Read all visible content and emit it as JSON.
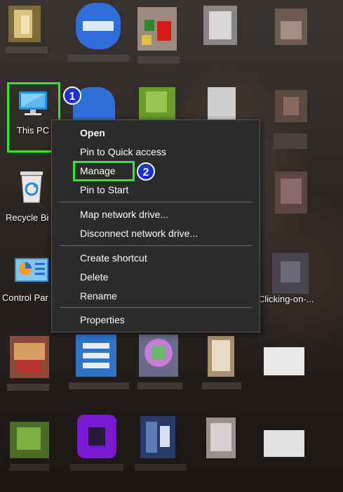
{
  "desktop": {
    "icons": [
      {
        "label": "This PC",
        "icon": "this-pc-icon"
      },
      {
        "label": "Recycle Bi",
        "icon": "recycle-bin-icon"
      },
      {
        "label": "Control Par",
        "icon": "control-panel-icon"
      }
    ],
    "partial_label": "Clicking-on-..."
  },
  "context_menu": {
    "items": [
      {
        "label": "Open",
        "bold": true
      },
      {
        "label": "Pin to Quick access"
      },
      {
        "label": "Manage"
      },
      {
        "label": "Pin to Start"
      },
      {
        "label": "Map network drive..."
      },
      {
        "label": "Disconnect network drive..."
      },
      {
        "label": "Create shortcut"
      },
      {
        "label": "Delete"
      },
      {
        "label": "Rename"
      },
      {
        "label": "Properties"
      }
    ]
  },
  "annotations": {
    "badge1": "1",
    "badge2": "2",
    "highlight_color": "#2ee62e",
    "badge_color": "#1a2fd8"
  }
}
